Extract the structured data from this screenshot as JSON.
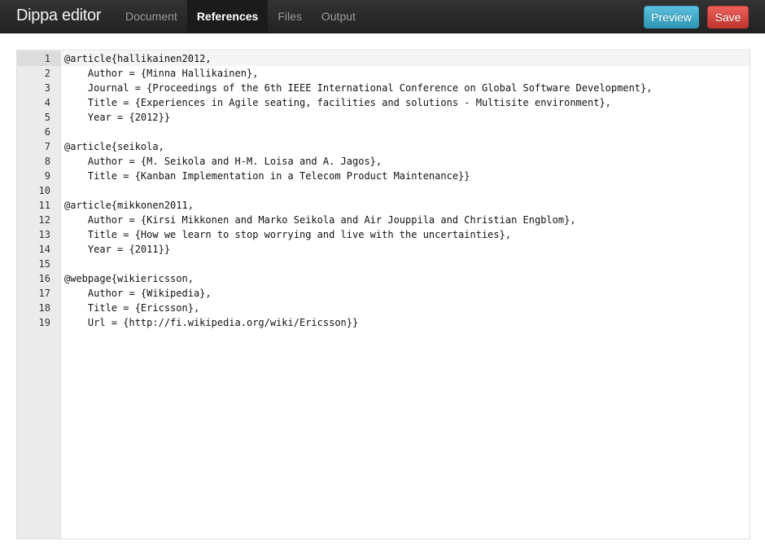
{
  "app": {
    "brand": "Dippa editor"
  },
  "nav": {
    "tabs": [
      {
        "label": "Document",
        "active": false
      },
      {
        "label": "References",
        "active": true
      },
      {
        "label": "Files",
        "active": false
      },
      {
        "label": "Output",
        "active": false
      }
    ]
  },
  "toolbar": {
    "preview_label": "Preview",
    "save_label": "Save"
  },
  "colors": {
    "navbar": "#222222",
    "preview": "#49afcd",
    "save": "#da4f49",
    "gutter": "#ebebeb"
  },
  "editor": {
    "active_line": 1,
    "lines": [
      {
        "num": "1",
        "text": "@article{hallikainen2012,"
      },
      {
        "num": "2",
        "text": "    Author = {Minna Hallikainen},"
      },
      {
        "num": "3",
        "text": "    Journal = {Proceedings of the 6th IEEE International Conference on Global Software Development},"
      },
      {
        "num": "4",
        "text": "    Title = {Experiences in Agile seating, facilities and solutions - Multisite environment},"
      },
      {
        "num": "5",
        "text": "    Year = {2012}}"
      },
      {
        "num": "6",
        "text": ""
      },
      {
        "num": "7",
        "text": "@article{seikola,"
      },
      {
        "num": "8",
        "text": "    Author = {M. Seikola and H-M. Loisa and A. Jagos},"
      },
      {
        "num": "9",
        "text": "    Title = {Kanban Implementation in a Telecom Product Maintenance}}"
      },
      {
        "num": "10",
        "text": ""
      },
      {
        "num": "11",
        "text": "@article{mikkonen2011,"
      },
      {
        "num": "12",
        "text": "    Author = {Kirsi Mikkonen and Marko Seikola and Air Jouppila and Christian Engblom},"
      },
      {
        "num": "13",
        "text": "    Title = {How we learn to stop worrying and live with the uncertainties},"
      },
      {
        "num": "14",
        "text": "    Year = {2011}}"
      },
      {
        "num": "15",
        "text": ""
      },
      {
        "num": "16",
        "text": "@webpage{wikiericsson,"
      },
      {
        "num": "17",
        "text": "    Author = {Wikipedia},"
      },
      {
        "num": "18",
        "text": "    Title = {Ericsson},"
      },
      {
        "num": "19",
        "text": "    Url = {http://fi.wikipedia.org/wiki/Ericsson}}"
      }
    ]
  }
}
